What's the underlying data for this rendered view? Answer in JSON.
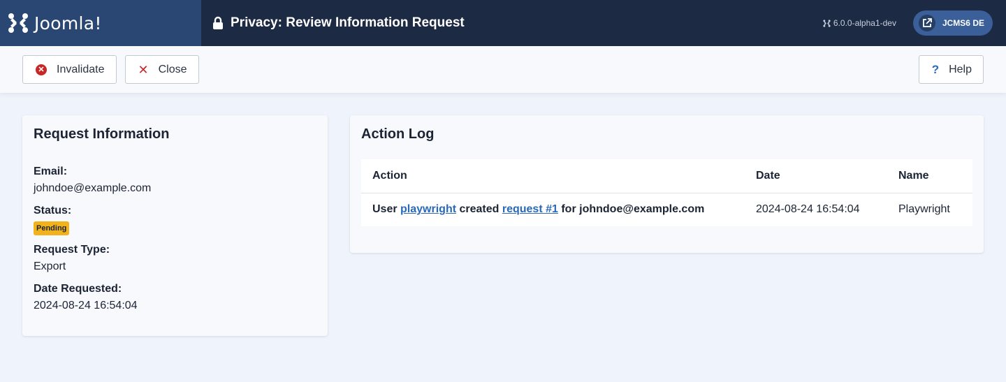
{
  "header": {
    "brand_name": "Joomla!",
    "page_title": "Privacy: Review Information Request",
    "version": "6.0.0-alpha1-dev",
    "site_button": "JCMS6 DE"
  },
  "toolbar": {
    "invalidate_label": "Invalidate",
    "close_label": "Close",
    "help_label": "Help"
  },
  "request_info": {
    "title": "Request Information",
    "email_label": "Email:",
    "email_value": "johndoe@example.com",
    "status_label": "Status:",
    "status_value": "Pending",
    "type_label": "Request Type:",
    "type_value": "Export",
    "date_label": "Date Requested:",
    "date_value": "2024-08-24 16:54:04"
  },
  "action_log": {
    "title": "Action Log",
    "columns": [
      "Action",
      "Date",
      "Name"
    ],
    "rows": [
      {
        "prefix": "User ",
        "user_link": "playwright",
        "middle": " created ",
        "request_link": "request #1",
        "suffix": " for johndoe@example.com",
        "date": "2024-08-24 16:54:04",
        "name": "Playwright"
      }
    ]
  },
  "colors": {
    "header_bg": "#1c2a44",
    "brand_bg": "#2a4672",
    "badge_warning": "#f2b21b",
    "danger": "#c52827",
    "link": "#2a69b8"
  }
}
